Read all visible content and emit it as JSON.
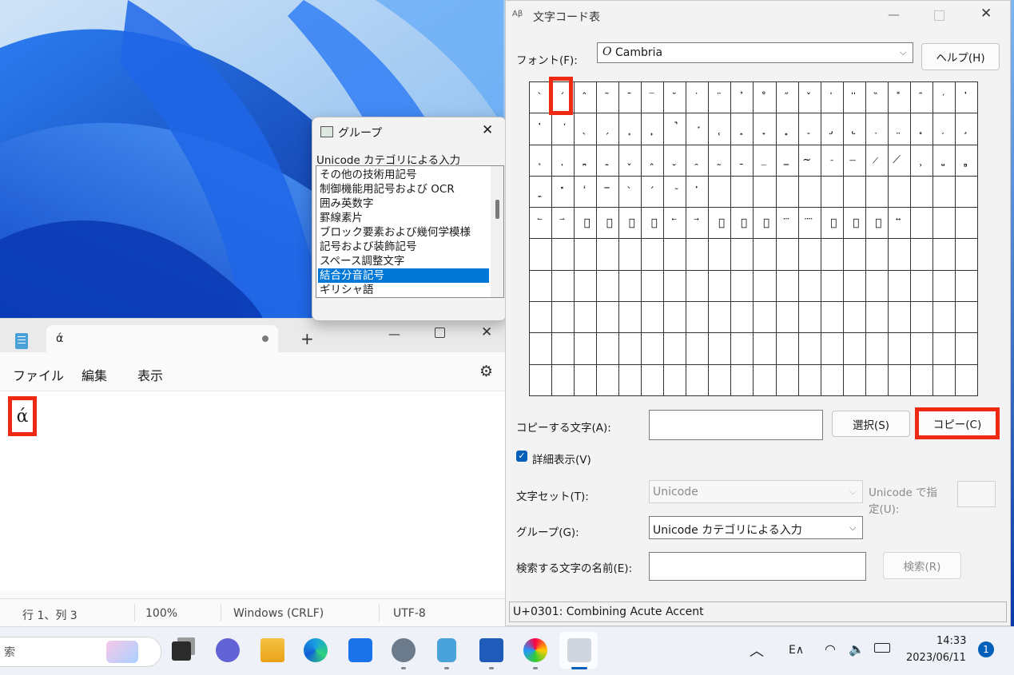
{
  "notepad": {
    "tab_title": "ά",
    "menu": [
      "ファイル",
      "編集",
      "表示"
    ],
    "content": "ά",
    "status": [
      "行 1、列 3",
      "100%",
      "Windows (CRLF)",
      "UTF-8"
    ]
  },
  "group_popup": {
    "title": "グループ",
    "label": "Unicode カテゴリによる入力",
    "items": [
      "その他の技術用記号",
      "制御機能用記号および OCR",
      "囲み英数字",
      "罫線素片",
      "ブロック要素および幾何学模様",
      "記号および装飾記号",
      "スペース調整文字",
      "結合分音記号",
      "ギリシャ語"
    ],
    "selected_index": 7
  },
  "charmap": {
    "title": "文字コード表",
    "font_label": "フォント(F):",
    "font_value": "Cambria",
    "font_glyph": "O",
    "help_label": "ヘルプ(H)",
    "grid_rows": [
      [
        "̀",
        "́",
        "̂",
        "̃",
        "̄",
        "̅",
        "̆",
        "̇",
        "̈",
        "̉",
        "̊",
        "̋",
        "̌",
        "̍",
        "̎",
        "̏",
        "̐",
        "̑",
        "̒",
        "̓"
      ],
      [
        "̔",
        "̕",
        "̖",
        "̗",
        "̘",
        "̙",
        "̚",
        "̛",
        "̜",
        "̝",
        "̞",
        "̟",
        "̠",
        "̡",
        "̢",
        "̣",
        "̤",
        "̥",
        "̦",
        "̧"
      ],
      [
        "̨",
        "̩",
        "̪",
        "̫",
        "̬",
        "̭",
        "̮",
        "̯",
        "̰",
        "̱",
        "̲",
        "̳",
        "̴",
        "̵",
        "̶",
        "̷",
        "̸",
        "̹",
        "̺",
        "̻"
      ],
      [
        "̼",
        "̽",
        "̾",
        "̿",
        "̀",
        "́",
        "͂",
        "̓",
        "",
        "",
        "",
        "",
        "",
        "",
        "",
        "",
        "",
        "",
        "",
        ""
      ],
      [
        "⃐",
        "⃑",
        "⃒",
        "⃓",
        "⃔",
        "⃕",
        "⃖",
        "⃗",
        "⃘",
        "⃙",
        "⃚",
        "⃛",
        "⃜",
        "⃝",
        "⃞",
        "⃟",
        "⃡",
        "",
        "",
        ""
      ],
      [
        "",
        "",
        "",
        "",
        "",
        "",
        "",
        "",
        "",
        "",
        "",
        "",
        "",
        "",
        "",
        "",
        "",
        "",
        "",
        ""
      ],
      [
        "",
        "",
        "",
        "",
        "",
        "",
        "",
        "",
        "",
        "",
        "",
        "",
        "",
        "",
        "",
        "",
        "",
        "",
        "",
        ""
      ],
      [
        "",
        "",
        "",
        "",
        "",
        "",
        "",
        "",
        "",
        "",
        "",
        "",
        "",
        "",
        "",
        "",
        "",
        "",
        "",
        ""
      ],
      [
        "",
        "",
        "",
        "",
        "",
        "",
        "",
        "",
        "",
        "",
        "",
        "",
        "",
        "",
        "",
        "",
        "",
        "",
        "",
        ""
      ],
      [
        "",
        "",
        "",
        "",
        "",
        "",
        "",
        "",
        "",
        "",
        "",
        "",
        "",
        "",
        "",
        "",
        "",
        "",
        "",
        ""
      ]
    ],
    "copy_chars_label": "コピーする文字(A):",
    "copy_chars_value": "",
    "select_label": "選択(S)",
    "copy_label": "コピー(C)",
    "advanced_label": "詳細表示(V)",
    "advanced_checked": true,
    "charset_label": "文字セット(T):",
    "charset_value": "Unicode",
    "unicode_goto_label_1": "Unicode で指",
    "unicode_goto_label_2": "定(U):",
    "group_label": "グループ(G):",
    "group_value": "Unicode カテゴリによる入力",
    "search_label": "検索する文字の名前(E):",
    "search_value": "",
    "search_button": "検索(R)",
    "status": "U+0301: Combining Acute Accent"
  },
  "taskbar": {
    "search_text": "索",
    "ime": "E∧",
    "time": "14:33",
    "date": "2023/06/11",
    "notification_count": "1"
  }
}
